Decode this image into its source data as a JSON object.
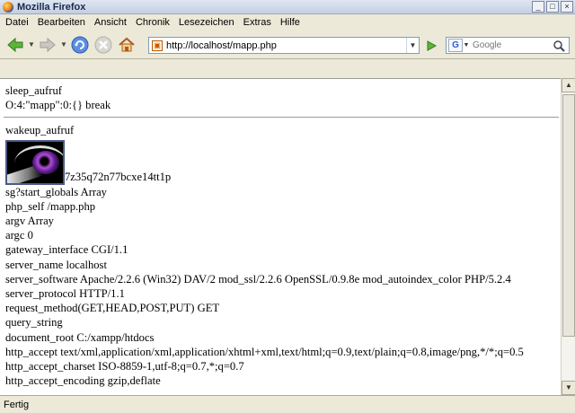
{
  "window": {
    "title": "Mozilla Firefox"
  },
  "menu": [
    "Datei",
    "Bearbeiten",
    "Ansicht",
    "Chronik",
    "Lesezeichen",
    "Extras",
    "Hilfe"
  ],
  "nav": {
    "url": "http://localhost/mapp.php",
    "search_placeholder": "Google",
    "search_engine_glyph": "G"
  },
  "content": {
    "block1": [
      "sleep_aufruf",
      "O:4:\"mapp\":0:{} break"
    ],
    "block2_title": "wakeup_aufruf",
    "image_caption": "7z35q72n77bcxe14tt1p",
    "lines": [
      "sg?start_globals Array",
      "php_self /mapp.php",
      "argv Array",
      "argc 0",
      "gateway_interface CGI/1.1",
      "server_name localhost",
      "server_software Apache/2.2.6 (Win32) DAV/2 mod_ssl/2.2.6 OpenSSL/0.9.8e mod_autoindex_color PHP/5.2.4",
      "server_protocol HTTP/1.1",
      "request_method(GET,HEAD,POST,PUT) GET",
      "query_string",
      "document_root C:/xampp/htdocs",
      "http_accept text/xml,application/xml,application/xhtml+xml,text/html;q=0.9,text/plain;q=0.8,image/png,*/*;q=0.5",
      "http_accept_charset ISO-8859-1,utf-8;q=0.7,*;q=0.7",
      "http_accept_encoding gzip,deflate"
    ]
  },
  "status": {
    "text": "Fertig"
  },
  "colors": {
    "chrome": "#ece9d8",
    "titlebar": "#c4cfe2",
    "page": "#ffffff",
    "accent": "#1a5fb4"
  }
}
